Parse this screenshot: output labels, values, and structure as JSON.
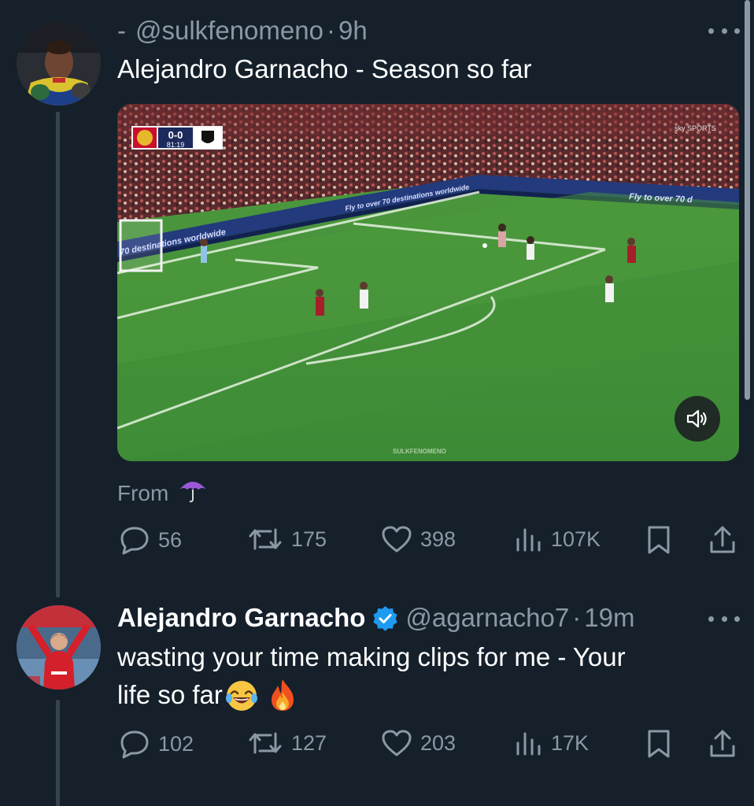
{
  "tweet1": {
    "dash": "-",
    "handle": "@sulkfenomeno",
    "sep": "·",
    "time": "9h",
    "text": "Alejandro Garnacho - Season so far",
    "media": {
      "scoreboard": "0-0",
      "clock": "81:19",
      "broadcaster": "sky SPORTS",
      "ad_left": "70 destinations worldwide",
      "ad_center": "Fly to over 70 destinations worldwide",
      "ad_right": "Fly to over 70 d",
      "watermark": "SULKFENOMENO"
    },
    "from_label": "From",
    "from_emoji": "☂️",
    "stats": {
      "replies": "56",
      "retweets": "175",
      "likes": "398",
      "views": "107K"
    }
  },
  "tweet2": {
    "name": "Alejandro Garnacho",
    "handle": "@agarnacho7",
    "sep": "·",
    "time": "19m",
    "text_line1": "wasting your time making clips for me - Your",
    "text_line2": "life so far",
    "emoji1": "😂",
    "emoji2": "🔥",
    "stats": {
      "replies": "102",
      "retweets": "127",
      "likes": "203",
      "views": "17K"
    }
  },
  "icons": {
    "reply": "reply-icon",
    "retweet": "retweet-icon",
    "like": "heart-icon",
    "views": "views-icon",
    "bookmark": "bookmark-icon",
    "share": "share-icon",
    "verified": "verified-badge-icon",
    "more": "more-icon",
    "sound": "speaker-icon"
  },
  "colors": {
    "background": "#15202b",
    "muted": "#8b98a5",
    "verified": "#1d9bf0",
    "pitch": "#3f8f3a"
  }
}
